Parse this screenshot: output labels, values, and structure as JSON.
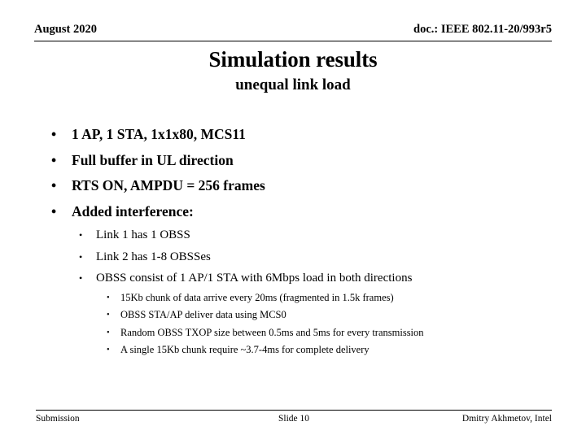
{
  "header": {
    "date": "August 2020",
    "doc": "doc.: IEEE 802.11-20/993r5"
  },
  "title": "Simulation results",
  "subtitle": "unequal link load",
  "bullet_char": "•",
  "bullets": [
    {
      "level": 1,
      "text": "1 AP, 1 STA, 1x1x80, MCS11"
    },
    {
      "level": 1,
      "text": "Full buffer in UL direction"
    },
    {
      "level": 1,
      "text": "RTS ON, AMPDU = 256 frames"
    },
    {
      "level": 1,
      "text": "Added interference:"
    },
    {
      "level": 2,
      "text": "Link 1 has 1 OBSS"
    },
    {
      "level": 2,
      "text": "Link 2 has 1-8 OBSSes"
    },
    {
      "level": 2,
      "text": "OBSS consist of 1 AP/1 STA with 6Mbps load in both directions"
    },
    {
      "level": 3,
      "text": "15Kb chunk of data arrive every 20ms (fragmented in 1.5k frames)"
    },
    {
      "level": 3,
      "text": "OBSS STA/AP deliver data using MCS0"
    },
    {
      "level": 3,
      "text": "Random OBSS TXOP size between 0.5ms and 5ms for every transmission"
    },
    {
      "level": 3,
      "text": "A single 15Kb chunk require ~3.7-4ms for complete delivery"
    }
  ],
  "footer": {
    "left": "Submission",
    "center": "Slide 10",
    "right": "Dmitry Akhmetov, Intel"
  },
  "colors": {
    "background": "#ffffff",
    "text": "#000000",
    "rule": "#000000"
  }
}
